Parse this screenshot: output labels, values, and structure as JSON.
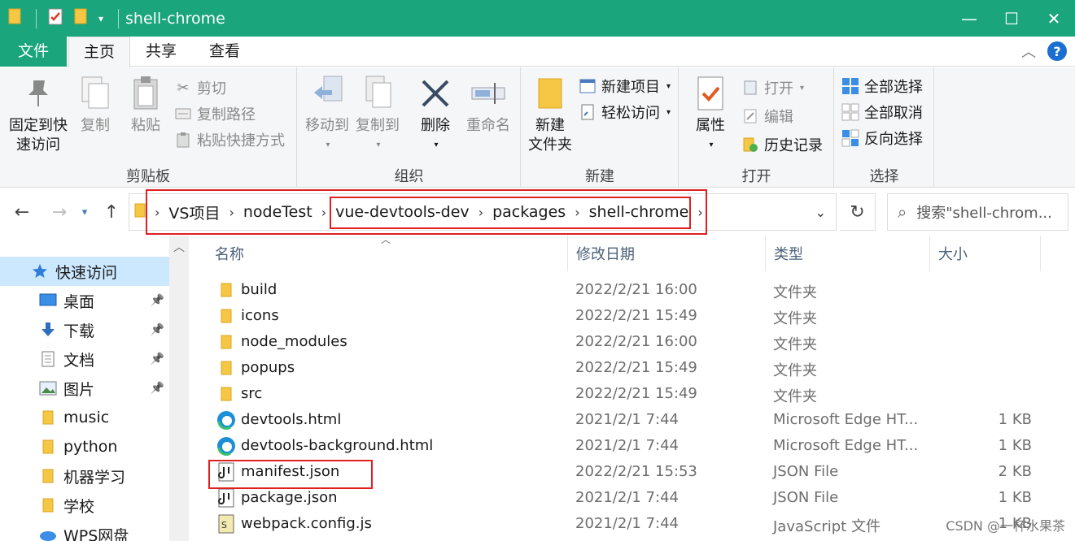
{
  "window": {
    "title": "shell-chrome",
    "controls": {
      "minimize": "—",
      "maximize": "☐",
      "close": "✕"
    },
    "qa_icons": [
      "folder-icon",
      "properties-icon",
      "folder-icon",
      "dropdown-icon"
    ]
  },
  "tabs": {
    "file": "文件",
    "home": "主页",
    "share": "共享",
    "view": "查看"
  },
  "ribbon": {
    "clipboard": {
      "label": "剪贴板",
      "pin_line1": "固定到快",
      "pin_line2": "速访问",
      "copy": "复制",
      "paste": "粘贴",
      "cut": "剪切",
      "copy_path": "复制路径",
      "paste_shortcut": "粘贴快捷方式"
    },
    "organize": {
      "label": "组织",
      "move_to": "移动到",
      "copy_to": "复制到",
      "delete": "删除",
      "rename": "重命名"
    },
    "new": {
      "label": "新建",
      "new_folder_line1": "新建",
      "new_folder_line2": "文件夹",
      "new_item": "新建项目",
      "easy_access": "轻松访问"
    },
    "open": {
      "label": "打开",
      "properties": "属性",
      "open": "打开",
      "edit": "编辑",
      "history": "历史记录"
    },
    "select": {
      "label": "选择",
      "select_all": "全部选择",
      "select_none": "全部取消",
      "invert": "反向选择"
    }
  },
  "address": {
    "crumbs": [
      "VS项目",
      "nodeTest",
      "vue-devtools-dev",
      "packages",
      "shell-chrome"
    ],
    "search_placeholder": "搜索\"shell-chrom..."
  },
  "navpane": {
    "items": [
      {
        "label": "快速访问",
        "icon": "star-icon",
        "pinned": false,
        "selected": true
      },
      {
        "label": "桌面",
        "icon": "desktop-icon",
        "pinned": true
      },
      {
        "label": "下载",
        "icon": "download-icon",
        "pinned": true
      },
      {
        "label": "文档",
        "icon": "document-icon",
        "pinned": true
      },
      {
        "label": "图片",
        "icon": "picture-icon",
        "pinned": true
      },
      {
        "label": "music",
        "icon": "folder-icon",
        "pinned": false
      },
      {
        "label": "python",
        "icon": "folder-icon",
        "pinned": false
      },
      {
        "label": "机器学习",
        "icon": "folder-icon",
        "pinned": false
      },
      {
        "label": "学校",
        "icon": "folder-icon",
        "pinned": false
      },
      {
        "label": "WPS网盘",
        "icon": "cloud-icon",
        "pinned": false
      }
    ]
  },
  "filelist": {
    "columns": {
      "name": "名称",
      "date": "修改日期",
      "type": "类型",
      "size": "大小"
    },
    "rows": [
      {
        "name": "build",
        "date": "2022/2/21 16:00",
        "type": "文件夹",
        "size": "",
        "icon": "folder-icon"
      },
      {
        "name": "icons",
        "date": "2022/2/21 15:49",
        "type": "文件夹",
        "size": "",
        "icon": "folder-icon"
      },
      {
        "name": "node_modules",
        "date": "2022/2/21 16:00",
        "type": "文件夹",
        "size": "",
        "icon": "folder-icon"
      },
      {
        "name": "popups",
        "date": "2022/2/21 15:49",
        "type": "文件夹",
        "size": "",
        "icon": "folder-icon"
      },
      {
        "name": "src",
        "date": "2022/2/21 15:49",
        "type": "文件夹",
        "size": "",
        "icon": "folder-icon"
      },
      {
        "name": "devtools.html",
        "date": "2021/2/1 7:44",
        "type": "Microsoft Edge HT...",
        "size": "1 KB",
        "icon": "edge-icon"
      },
      {
        "name": "devtools-background.html",
        "date": "2021/2/1 7:44",
        "type": "Microsoft Edge HT...",
        "size": "1 KB",
        "icon": "edge-icon"
      },
      {
        "name": "manifest.json",
        "date": "2022/2/21 15:53",
        "type": "JSON File",
        "size": "2 KB",
        "icon": "json-icon"
      },
      {
        "name": "package.json",
        "date": "2021/2/1 7:44",
        "type": "JSON File",
        "size": "1 KB",
        "icon": "json-icon"
      },
      {
        "name": "webpack.config.js",
        "date": "2021/2/1 7:44",
        "type": "JavaScript 文件",
        "size": "1 KB",
        "icon": "js-icon"
      }
    ]
  },
  "watermark": "CSDN @一杯水果茶",
  "colors": {
    "accent": "#1aa57c",
    "selection": "#cce8ff",
    "highlight": "#e02020"
  }
}
